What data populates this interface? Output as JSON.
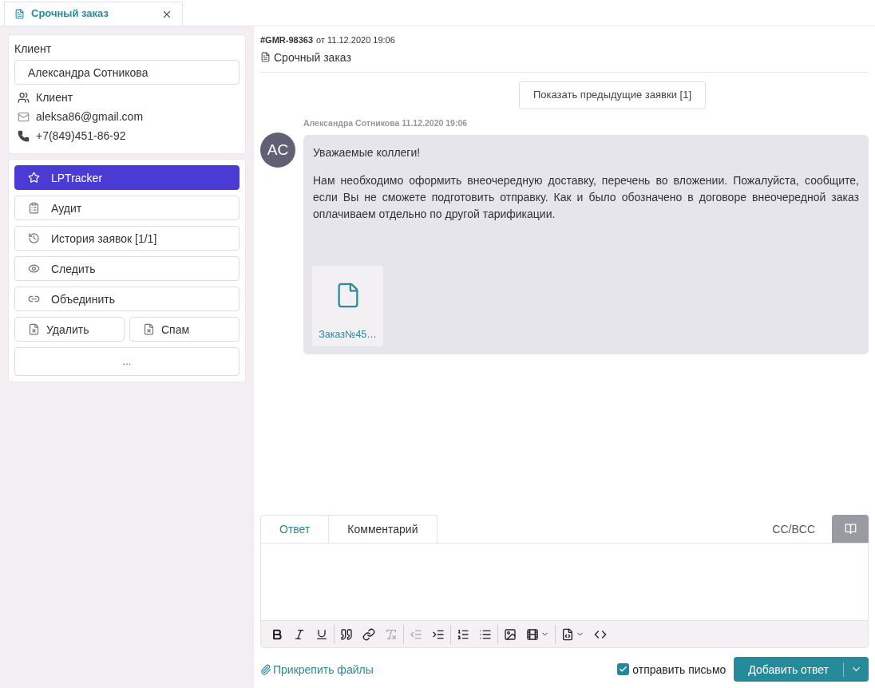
{
  "tab": {
    "title": "Срочный заказ",
    "selected": true
  },
  "client": {
    "label": "Клиент",
    "name": "Александра Сотникова",
    "type": "Клиент",
    "email": "aleksa86@gmail.com",
    "phone": "+7(849)451-86-92"
  },
  "actions": [
    {
      "kind": "star",
      "label": "LPTracker",
      "selected": true
    },
    {
      "kind": "audit",
      "label": "Аудит",
      "selected": false
    },
    {
      "kind": "history",
      "label": "История заявок [1/1]",
      "selected": false
    },
    {
      "kind": "watch",
      "label": "Следить",
      "selected": false
    },
    {
      "kind": "merge",
      "label": "Объединить",
      "selected": false
    }
  ],
  "half_actions": [
    {
      "label": "Удалить"
    },
    {
      "label": "Спам"
    }
  ],
  "more_button": "...",
  "ticket": {
    "number": "#GMR-98363",
    "date_prefix": "от",
    "date": "11.12.2020 19:06",
    "subject": "Срочный заказ"
  },
  "show_previous_button": "Показать предыдущие заявки [1]",
  "message": {
    "author": "Александра Сотникова",
    "time": "11.12.2020 19:06",
    "initials": "AC",
    "paragraphs": [
      "Уважаемые коллеги!",
      "Нам необходимо оформить внеочередную доставку, перечень во вложении. Пожалуйста, сообщите, если Вы не сможете подготовить отправку. Как и было обозначено в договоре внеочередной заказ оплачиваем отдельно по другой тарификации."
    ],
    "attachment": "Заказ№45…"
  },
  "editor": {
    "tabs": [
      {
        "label": "Ответ",
        "selected": true
      },
      {
        "label": "Комментарий",
        "selected": false
      }
    ],
    "cc_bcc": "CC/BCC",
    "toolbar": [
      [
        {
          "kind": "bold",
          "disabled": false
        },
        {
          "kind": "italic",
          "disabled": false
        },
        {
          "kind": "underline",
          "disabled": false
        }
      ],
      [
        {
          "kind": "quote",
          "disabled": false
        },
        {
          "kind": "link",
          "disabled": false
        },
        {
          "kind": "clear",
          "disabled": true
        }
      ],
      [
        {
          "kind": "outdent",
          "disabled": true
        },
        {
          "kind": "indent",
          "disabled": false
        }
      ],
      [
        {
          "kind": "ordered",
          "disabled": false
        },
        {
          "kind": "bullets",
          "disabled": false
        }
      ],
      [
        {
          "kind": "image",
          "disabled": false
        },
        {
          "kind": "video",
          "disabled": false
        }
      ],
      [
        {
          "kind": "template",
          "disabled": false
        },
        {
          "kind": "code",
          "disabled": false
        }
      ]
    ]
  },
  "footer": {
    "attach_link": "Прикрепить файлы",
    "send_email": {
      "label": "отправить письмо",
      "checked": true
    },
    "submit_button": "Добавить ответ"
  }
}
